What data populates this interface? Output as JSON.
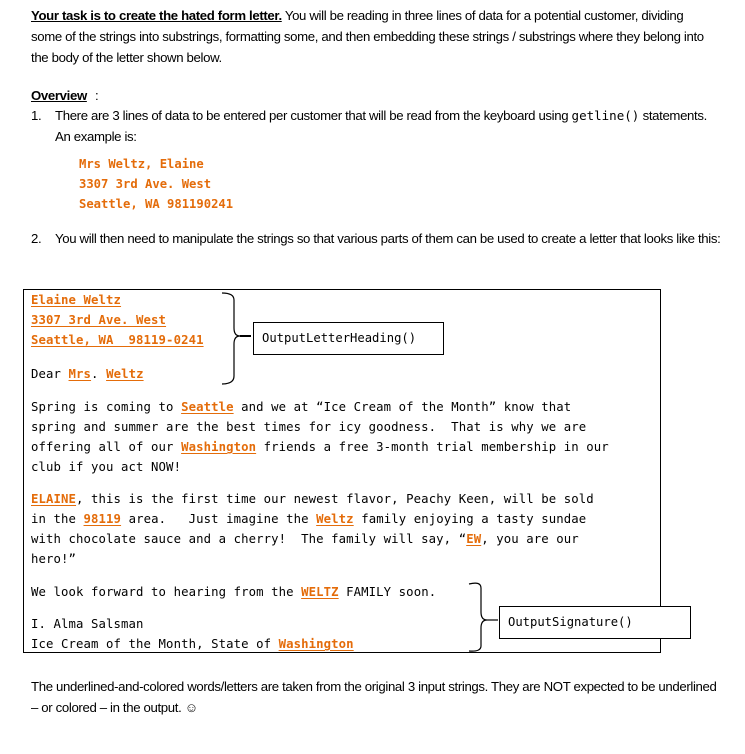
{
  "intro": {
    "lead": "Your task is to create the hated form letter.",
    "rest": "  You will be reading in three lines of data for a potential customer, dividing some of the strings into substrings, formatting some, and then embedding these strings / substrings where they belong into the body of the letter shown below."
  },
  "overview": {
    "heading": "Overview",
    "colon": ":",
    "items": [
      {
        "number": "1.",
        "text_before": "There are 3 lines of data to be entered per customer that will be read from the keyboard using ",
        "code": "getline()",
        "text_after": " statements.  An example is:"
      },
      {
        "number": "2.",
        "text": "You will then need to manipulate the strings so that various parts of them can be used to create a letter that looks like this:"
      }
    ],
    "example_input": [
      "Mrs Weltz, Elaine",
      "3307 3rd Ave. West",
      "Seattle, WA 981190241"
    ]
  },
  "letter": {
    "heading": {
      "name": "Elaine Weltz",
      "street": "3307 3rd Ave. West",
      "city_line": "Seattle, WA  98119-0241",
      "salutation_prefix": "Dear ",
      "title": "Mrs",
      "title_dot": ". ",
      "last_name": "Weltz"
    },
    "para1": {
      "t1": "Spring is coming to ",
      "city": "Seattle",
      "t2": " and we at “Ice Cream of the Month” know that",
      "line2": "spring and summer are the best times for icy goodness.  That is why we are",
      "t3": "offering all of our ",
      "state": "Washington",
      "t4": " friends a free 3-month trial membership in our",
      "line4": "club if you act NOW!"
    },
    "para2": {
      "first_upper": "ELAINE",
      "t1": ", this is the first time our newest flavor, Peachy Keen, will be sold",
      "t2": "in the ",
      "zip": "98119",
      "t3": " area.   Just imagine the ",
      "last": "Weltz",
      "t4": " family enjoying a tasty sundae",
      "t5": "with chocolate sauce and a cherry!  The family will say, “",
      "initials": "EW",
      "t6": ", you are our",
      "line4": "hero!”"
    },
    "closing": {
      "t1": "We look forward to hearing from the ",
      "last_upper": "WELTZ",
      "t2": " FAMILY soon.",
      "signer": "I. Alma Salsman",
      "org_prefix": "Ice Cream of the Month, State of ",
      "state": "Washington"
    },
    "labels": {
      "heading_function": "OutputLetterHeading()",
      "signature_function": "OutputSignature()"
    }
  },
  "footer": {
    "text": "The underlined-and-colored words/letters are taken from the original 3 input strings.  They are NOT expected to be underlined – or colored – in the output. ",
    "smiley": "☺"
  },
  "colors": {
    "accent": "#e46c0a"
  }
}
